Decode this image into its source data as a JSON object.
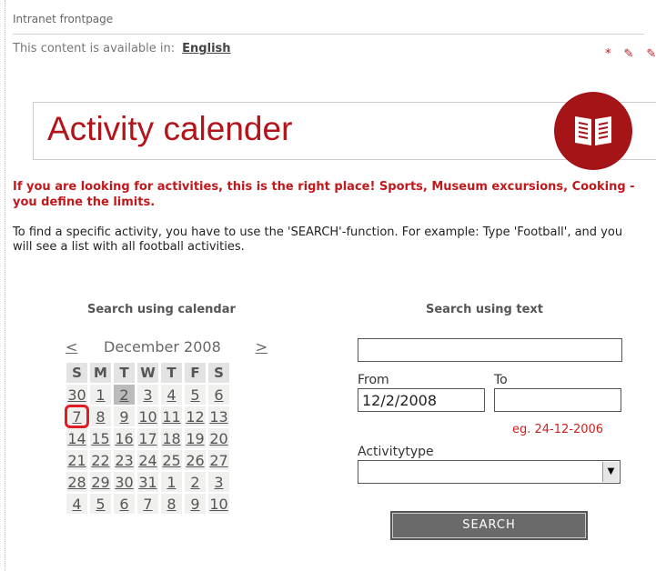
{
  "breadcrumb": "Intranet frontpage",
  "language": {
    "label": "This content is available in:",
    "link": "English"
  },
  "title": "Activity calender",
  "intro_red": "If you are looking for activities, this is the right place! Sports, Museum excursions, Cooking - you define the limits.",
  "intro": "To find a specific activity, you have to use the 'SEARCH'-function. For example: Type 'Football', and you will see a list with all football activities.",
  "calendar": {
    "heading": "Search using calendar",
    "prev": "<",
    "next": ">",
    "month": "December 2008",
    "weekdays": [
      "S",
      "M",
      "T",
      "W",
      "T",
      "F",
      "S"
    ],
    "weeks": [
      [
        "30",
        "1",
        "2",
        "3",
        "4",
        "5",
        "6"
      ],
      [
        "7",
        "8",
        "9",
        "10",
        "11",
        "12",
        "13"
      ],
      [
        "14",
        "15",
        "16",
        "17",
        "18",
        "19",
        "20"
      ],
      [
        "21",
        "22",
        "23",
        "24",
        "25",
        "26",
        "27"
      ],
      [
        "28",
        "29",
        "30",
        "31",
        "1",
        "2",
        "3"
      ],
      [
        "4",
        "5",
        "6",
        "7",
        "8",
        "9",
        "10"
      ]
    ],
    "today": "2",
    "highlighted": "7"
  },
  "text_search": {
    "heading": "Search using text",
    "query_value": "",
    "from_label": "From",
    "from_value": "12/2/2008",
    "to_label": "To",
    "to_value": "",
    "date_hint": "eg. 24-12-2006",
    "activitytype_label": "Activitytype",
    "activitytype_value": "",
    "search_button": "SEARCH"
  },
  "colors": {
    "accent": "#b3141a",
    "badge": "#a51417"
  },
  "icons": [
    "add-edit-icon",
    "edit-icon",
    "book-icon",
    "dropdown-arrow-icon"
  ]
}
